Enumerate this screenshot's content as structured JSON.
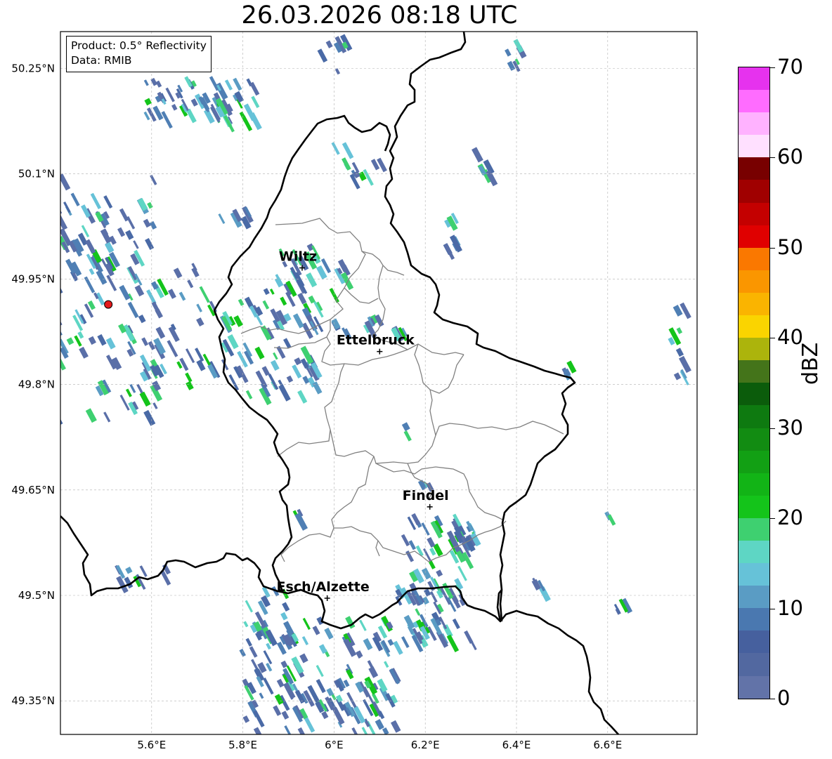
{
  "title": "26.03.2026 08:18 UTC",
  "info": {
    "product": "Product: 0.5° Reflectivity",
    "data": "Data: RMIB"
  },
  "map": {
    "lon_range": [
      5.4,
      6.8
    ],
    "lat_range": [
      49.32,
      50.29
    ],
    "lon_ticks": [
      {
        "value": 5.6,
        "label": "5.6°E"
      },
      {
        "value": 5.8,
        "label": "5.8°E"
      },
      {
        "value": 6.0,
        "label": "6°E"
      },
      {
        "value": 6.2,
        "label": "6.2°E"
      },
      {
        "value": 6.4,
        "label": "6.4°E"
      },
      {
        "value": 6.6,
        "label": "6.6°E"
      }
    ],
    "lat_ticks": [
      {
        "value": 49.35,
        "label": "49.35°N"
      },
      {
        "value": 49.5,
        "label": "49.5°N"
      },
      {
        "value": 49.65,
        "label": "49.65°N"
      },
      {
        "value": 49.8,
        "label": "49.8°N"
      },
      {
        "value": 49.95,
        "label": "49.95°N"
      },
      {
        "value": 50.1,
        "label": "50.1°N"
      },
      {
        "value": 50.25,
        "label": "50.25°N"
      }
    ],
    "grid": true,
    "radar_site": {
      "lon": 5.505,
      "lat": 49.914,
      "color": "#e31a1c"
    },
    "cities": [
      {
        "name": "Wiltz",
        "lon": 5.93,
        "lat": 49.966
      },
      {
        "name": "Ettelbruck",
        "lon": 6.1,
        "lat": 49.847
      },
      {
        "name": "Findel",
        "lon": 6.21,
        "lat": 49.626
      },
      {
        "name": "Esch/Alzette",
        "lon": 5.985,
        "lat": 49.496
      }
    ]
  },
  "colorbar": {
    "label": "dBZ",
    "min": 0,
    "max": 70,
    "ticks": [
      "0",
      "10",
      "20",
      "30",
      "40",
      "50",
      "60",
      "70"
    ],
    "colors": [
      "#6273a8",
      "#5268a0",
      "#46609e",
      "#4a78b0",
      "#5a9cc4",
      "#66c2d8",
      "#5ed6c4",
      "#3ed070",
      "#14c41a",
      "#12b416",
      "#12a014",
      "#128c12",
      "#0e7a10",
      "#0b5c0b",
      "#44741a",
      "#acb40c",
      "#fad400",
      "#fab400",
      "#fa9600",
      "#fa7800",
      "#e00000",
      "#c40000",
      "#a00000",
      "#780000",
      "#ffe0ff",
      "#ffb2ff",
      "#ff6cff",
      "#e632ee"
    ]
  }
}
